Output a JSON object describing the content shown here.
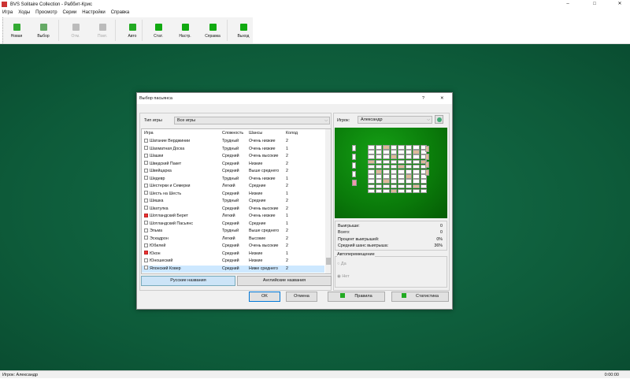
{
  "window": {
    "title": "BVS Solitaire Collection  -  Раббит-Крис",
    "minimize": "–",
    "maximize": "□",
    "close": "✕"
  },
  "menu": [
    "Игра",
    "Ходы",
    "Просмотр",
    "Серии",
    "Настройки",
    "Справка"
  ],
  "toolbar": [
    {
      "label": "Новая",
      "icon": "new-game-icon",
      "enabled": true,
      "color": "#3a3"
    },
    {
      "label": "Выбор",
      "icon": "select-game-icon",
      "enabled": true,
      "color": "#6a6"
    },
    {
      "label": "Отм.",
      "icon": "undo-icon",
      "enabled": false,
      "color": "#bbb"
    },
    {
      "label": "Повт.",
      "icon": "redo-icon",
      "enabled": false,
      "color": "#bbb"
    },
    {
      "label": "Авто",
      "icon": "auto-icon",
      "enabled": true,
      "color": "#2a2"
    },
    {
      "label": "Стат.",
      "icon": "stats-icon",
      "enabled": true,
      "color": "#1a1"
    },
    {
      "label": "Настр.",
      "icon": "settings-icon",
      "enabled": true,
      "color": "#1a1"
    },
    {
      "label": "Справка",
      "icon": "help-icon",
      "enabled": true,
      "color": "#1a1"
    },
    {
      "label": "Выход",
      "icon": "exit-icon",
      "enabled": true,
      "color": "#1a1"
    }
  ],
  "status": {
    "player": "Игрок: Александр",
    "time": "0:00:00"
  },
  "dialog": {
    "title": "Выбор пасьянса",
    "help": "?",
    "close": "✕",
    "game_type_label": "Тип игры",
    "game_type_value": "Все игры",
    "columns": [
      "Игра",
      "Сложность",
      "Шансы",
      "Колод"
    ],
    "games": [
      {
        "name": "Шатание Верджинии",
        "difficulty": "Трудный",
        "chances": "Очень низкие",
        "decks": "2",
        "checked": false
      },
      {
        "name": "Шахматная Доска",
        "difficulty": "Трудный",
        "chances": "Очень низкие",
        "decks": "1",
        "checked": false
      },
      {
        "name": "Шашки",
        "difficulty": "Средний",
        "chances": "Очень высокие",
        "decks": "2",
        "checked": false
      },
      {
        "name": "Шведский Пакет",
        "difficulty": "Средний",
        "chances": "Низкие",
        "decks": "2",
        "checked": false
      },
      {
        "name": "Швейцарка",
        "difficulty": "Средний",
        "chances": "Выше среднего",
        "decks": "2",
        "checked": false
      },
      {
        "name": "Шедевр",
        "difficulty": "Трудный",
        "chances": "Очень низкие",
        "decks": "1",
        "checked": false
      },
      {
        "name": "Шестерки и Семерки",
        "difficulty": "Легкий",
        "chances": "Средние",
        "decks": "2",
        "checked": false
      },
      {
        "name": "Шесть на Шесть",
        "difficulty": "Средний",
        "chances": "Низкие",
        "decks": "1",
        "checked": false
      },
      {
        "name": "Шишка",
        "difficulty": "Трудный",
        "chances": "Средние",
        "decks": "2",
        "checked": false
      },
      {
        "name": "Шкатулка",
        "difficulty": "Средний",
        "chances": "Очень высокие",
        "decks": "2",
        "checked": false
      },
      {
        "name": "Шотландский Берет",
        "difficulty": "Легкий",
        "chances": "Очень низкие",
        "decks": "1",
        "checked": true
      },
      {
        "name": "Шотландский Пасьянс",
        "difficulty": "Средний",
        "chances": "Средние",
        "decks": "1",
        "checked": false
      },
      {
        "name": "Эльма",
        "difficulty": "Трудный",
        "chances": "Выше среднего",
        "decks": "2",
        "checked": false
      },
      {
        "name": "Эскадрон",
        "difficulty": "Легкий",
        "chances": "Высокие",
        "decks": "2",
        "checked": false
      },
      {
        "name": "Юбилей",
        "difficulty": "Средний",
        "chances": "Очень высокие",
        "decks": "2",
        "checked": false
      },
      {
        "name": "Юкон",
        "difficulty": "Средний",
        "chances": "Низкие",
        "decks": "1",
        "checked": true
      },
      {
        "name": "Юношеский",
        "difficulty": "Средний",
        "chances": "Низкие",
        "decks": "2",
        "checked": false
      },
      {
        "name": "Японский Ковер",
        "difficulty": "Средний",
        "chances": "Ниже среднего",
        "decks": "2",
        "checked": false,
        "selected": true
      }
    ],
    "russian_names": "Русские названия",
    "english_names": "Английские названия",
    "player_label": "Игрок:",
    "player_value": "Александр",
    "stats": [
      {
        "label": "Выигрыши:",
        "value": "0"
      },
      {
        "label": "Всего:",
        "value": "0"
      },
      {
        "label": "Процент выигрышей:",
        "value": "0%"
      },
      {
        "label": "Средний шанс выигрыша:",
        "value": "36%"
      }
    ],
    "autoplace": {
      "title": "Автоперемещение",
      "yes": "Да",
      "no": "Нет",
      "selected": "no"
    },
    "ok": "OK",
    "cancel": "Отмена",
    "rules": "Правила",
    "statistics": "Статистика"
  }
}
